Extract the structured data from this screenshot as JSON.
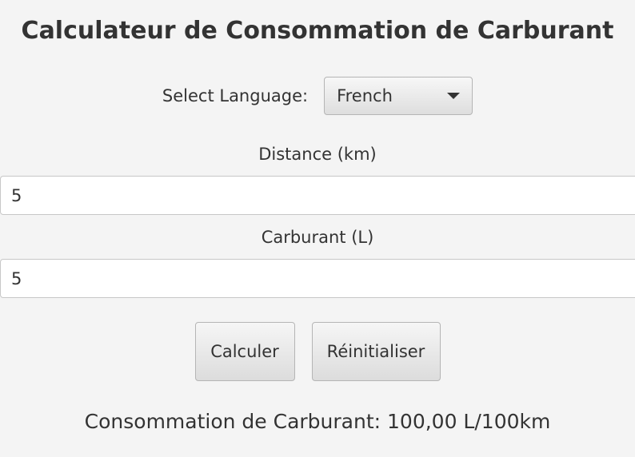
{
  "header": {
    "title": "Calculateur de Consommation de Carburant"
  },
  "language": {
    "label": "Select Language:",
    "selected": "French"
  },
  "distance": {
    "label": "Distance (km)",
    "value": "5"
  },
  "fuel": {
    "label": "Carburant (L)",
    "value": "5"
  },
  "buttons": {
    "calculate": "Calculer",
    "reset": "Réinitialiser"
  },
  "result": {
    "text": "Consommation de Carburant: 100,00 L/100km"
  },
  "icons": {
    "dropdown": "chevron-down-icon"
  }
}
